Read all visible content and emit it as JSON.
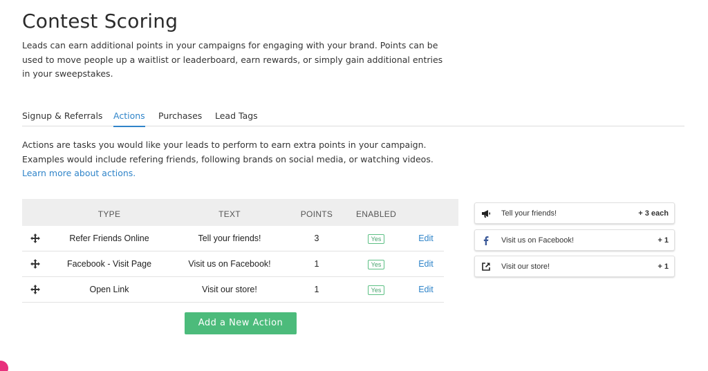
{
  "page": {
    "title": "Contest Scoring",
    "intro": "Leads can earn additional points in your campaigns for engaging with your brand. Points can be used to move people up a waitlist or leaderboard, earn rewards, or simply gain additional entries in your sweepstakes."
  },
  "tabs": [
    {
      "label": "Signup & Referrals",
      "active": false
    },
    {
      "label": "Actions",
      "active": true
    },
    {
      "label": "Purchases",
      "active": false
    },
    {
      "label": "Lead Tags",
      "active": false
    }
  ],
  "description": {
    "text": "Actions are tasks you would like your leads to perform to earn extra points in your campaign. Examples would include refering friends, following brands on social media, or watching videos. ",
    "link": "Learn more about actions."
  },
  "table": {
    "headers": {
      "type": "TYPE",
      "text": "TEXT",
      "points": "POINTS",
      "enabled": "ENABLED"
    },
    "rows": [
      {
        "type": "Refer Friends Online",
        "text": "Tell your friends!",
        "points": "3",
        "enabled": "Yes",
        "edit": "Edit",
        "drag_icon": "move-icon"
      },
      {
        "type": "Facebook - Visit Page",
        "text": "Visit us on Facebook!",
        "points": "1",
        "enabled": "Yes",
        "edit": "Edit",
        "drag_icon": "move-icon"
      },
      {
        "type": "Open Link",
        "text": "Visit our store!",
        "points": "1",
        "enabled": "Yes",
        "edit": "Edit",
        "drag_icon": "move-icon"
      }
    ]
  },
  "add_button": {
    "label": "Add a New Action"
  },
  "preview": [
    {
      "icon": "megaphone-icon",
      "text": "Tell your friends!",
      "points": "+ 3 each"
    },
    {
      "icon": "facebook-icon",
      "text": "Visit us on Facebook!",
      "points": "+ 1"
    },
    {
      "icon": "external-link-icon",
      "text": "Visit our store!",
      "points": "+ 1"
    }
  ],
  "colors": {
    "accent": "#2f84c9",
    "button": "#4cbb7b",
    "badge": "#5bbf83",
    "header_bg": "#eeeeee"
  }
}
